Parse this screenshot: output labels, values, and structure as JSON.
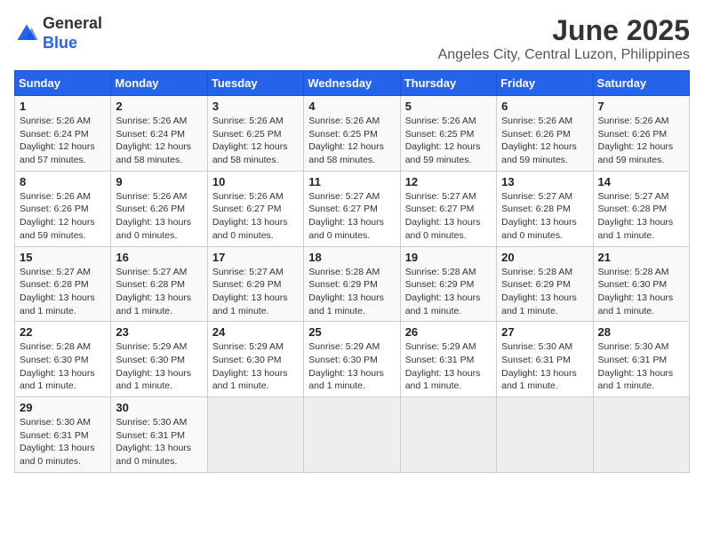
{
  "logo": {
    "general": "General",
    "blue": "Blue"
  },
  "title": "June 2025",
  "subtitle": "Angeles City, Central Luzon, Philippines",
  "weekdays": [
    "Sunday",
    "Monday",
    "Tuesday",
    "Wednesday",
    "Thursday",
    "Friday",
    "Saturday"
  ],
  "weeks": [
    [
      {
        "day": "1",
        "detail": "Sunrise: 5:26 AM\nSunset: 6:24 PM\nDaylight: 12 hours\nand 57 minutes."
      },
      {
        "day": "2",
        "detail": "Sunrise: 5:26 AM\nSunset: 6:24 PM\nDaylight: 12 hours\nand 58 minutes."
      },
      {
        "day": "3",
        "detail": "Sunrise: 5:26 AM\nSunset: 6:25 PM\nDaylight: 12 hours\nand 58 minutes."
      },
      {
        "day": "4",
        "detail": "Sunrise: 5:26 AM\nSunset: 6:25 PM\nDaylight: 12 hours\nand 58 minutes."
      },
      {
        "day": "5",
        "detail": "Sunrise: 5:26 AM\nSunset: 6:25 PM\nDaylight: 12 hours\nand 59 minutes."
      },
      {
        "day": "6",
        "detail": "Sunrise: 5:26 AM\nSunset: 6:26 PM\nDaylight: 12 hours\nand 59 minutes."
      },
      {
        "day": "7",
        "detail": "Sunrise: 5:26 AM\nSunset: 6:26 PM\nDaylight: 12 hours\nand 59 minutes."
      }
    ],
    [
      {
        "day": "8",
        "detail": "Sunrise: 5:26 AM\nSunset: 6:26 PM\nDaylight: 12 hours\nand 59 minutes."
      },
      {
        "day": "9",
        "detail": "Sunrise: 5:26 AM\nSunset: 6:26 PM\nDaylight: 13 hours\nand 0 minutes."
      },
      {
        "day": "10",
        "detail": "Sunrise: 5:26 AM\nSunset: 6:27 PM\nDaylight: 13 hours\nand 0 minutes."
      },
      {
        "day": "11",
        "detail": "Sunrise: 5:27 AM\nSunset: 6:27 PM\nDaylight: 13 hours\nand 0 minutes."
      },
      {
        "day": "12",
        "detail": "Sunrise: 5:27 AM\nSunset: 6:27 PM\nDaylight: 13 hours\nand 0 minutes."
      },
      {
        "day": "13",
        "detail": "Sunrise: 5:27 AM\nSunset: 6:28 PM\nDaylight: 13 hours\nand 0 minutes."
      },
      {
        "day": "14",
        "detail": "Sunrise: 5:27 AM\nSunset: 6:28 PM\nDaylight: 13 hours\nand 1 minute."
      }
    ],
    [
      {
        "day": "15",
        "detail": "Sunrise: 5:27 AM\nSunset: 6:28 PM\nDaylight: 13 hours\nand 1 minute."
      },
      {
        "day": "16",
        "detail": "Sunrise: 5:27 AM\nSunset: 6:28 PM\nDaylight: 13 hours\nand 1 minute."
      },
      {
        "day": "17",
        "detail": "Sunrise: 5:27 AM\nSunset: 6:29 PM\nDaylight: 13 hours\nand 1 minute."
      },
      {
        "day": "18",
        "detail": "Sunrise: 5:28 AM\nSunset: 6:29 PM\nDaylight: 13 hours\nand 1 minute."
      },
      {
        "day": "19",
        "detail": "Sunrise: 5:28 AM\nSunset: 6:29 PM\nDaylight: 13 hours\nand 1 minute."
      },
      {
        "day": "20",
        "detail": "Sunrise: 5:28 AM\nSunset: 6:29 PM\nDaylight: 13 hours\nand 1 minute."
      },
      {
        "day": "21",
        "detail": "Sunrise: 5:28 AM\nSunset: 6:30 PM\nDaylight: 13 hours\nand 1 minute."
      }
    ],
    [
      {
        "day": "22",
        "detail": "Sunrise: 5:28 AM\nSunset: 6:30 PM\nDaylight: 13 hours\nand 1 minute."
      },
      {
        "day": "23",
        "detail": "Sunrise: 5:29 AM\nSunset: 6:30 PM\nDaylight: 13 hours\nand 1 minute."
      },
      {
        "day": "24",
        "detail": "Sunrise: 5:29 AM\nSunset: 6:30 PM\nDaylight: 13 hours\nand 1 minute."
      },
      {
        "day": "25",
        "detail": "Sunrise: 5:29 AM\nSunset: 6:30 PM\nDaylight: 13 hours\nand 1 minute."
      },
      {
        "day": "26",
        "detail": "Sunrise: 5:29 AM\nSunset: 6:31 PM\nDaylight: 13 hours\nand 1 minute."
      },
      {
        "day": "27",
        "detail": "Sunrise: 5:30 AM\nSunset: 6:31 PM\nDaylight: 13 hours\nand 1 minute."
      },
      {
        "day": "28",
        "detail": "Sunrise: 5:30 AM\nSunset: 6:31 PM\nDaylight: 13 hours\nand 1 minute."
      }
    ],
    [
      {
        "day": "29",
        "detail": "Sunrise: 5:30 AM\nSunset: 6:31 PM\nDaylight: 13 hours\nand 0 minutes."
      },
      {
        "day": "30",
        "detail": "Sunrise: 5:30 AM\nSunset: 6:31 PM\nDaylight: 13 hours\nand 0 minutes."
      },
      null,
      null,
      null,
      null,
      null
    ]
  ]
}
